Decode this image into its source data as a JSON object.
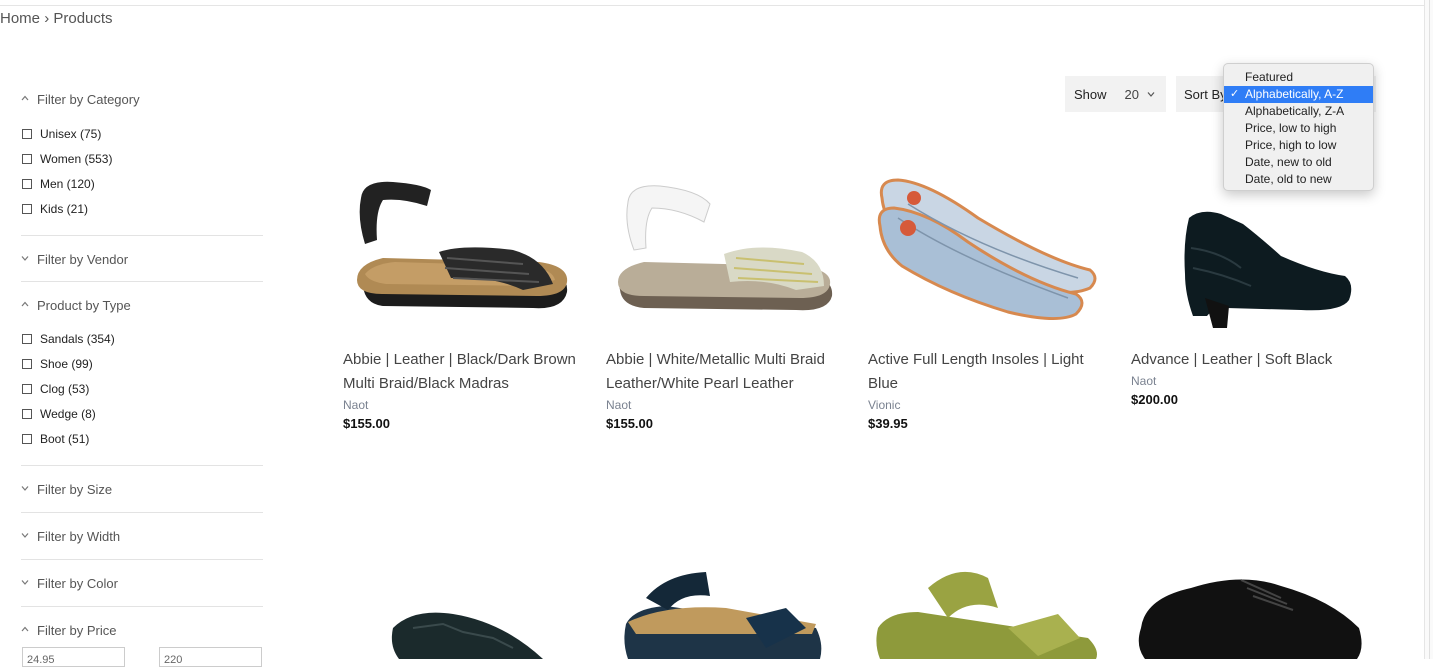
{
  "breadcrumb": {
    "home": "Home",
    "separator": "›",
    "current": "Products"
  },
  "filters": [
    {
      "title": "Filter by Category",
      "expanded": true,
      "options": [
        "Unisex (75)",
        "Women (553)",
        "Men (120)",
        "Kids (21)"
      ]
    },
    {
      "title": "Filter by Vendor",
      "expanded": false,
      "options": []
    },
    {
      "title": "Product by Type",
      "expanded": true,
      "options": [
        "Sandals (354)",
        "Shoe (99)",
        "Clog (53)",
        "Wedge (8)",
        "Boot (51)"
      ]
    },
    {
      "title": "Filter by Size",
      "expanded": false,
      "options": []
    },
    {
      "title": "Filter by Width",
      "expanded": false,
      "options": []
    },
    {
      "title": "Filter by Color",
      "expanded": false,
      "options": []
    },
    {
      "title": "Filter by Price",
      "expanded": true,
      "options": []
    }
  ],
  "price_inputs": {
    "min": "24.95",
    "max": "220"
  },
  "toolbar": {
    "show_label": "Show",
    "show_value": "20",
    "sort_label": "Sort By"
  },
  "sort_dropdown": {
    "selected": "Alphabetically, A-Z",
    "check": "✓",
    "options": [
      "Featured",
      "Alphabetically, A-Z",
      "Alphabetically, Z-A",
      "Price, low to high",
      "Price, high to low",
      "Date, new to old",
      "Date, old to new"
    ]
  },
  "products": [
    {
      "title": "Abbie | Leather | Black/Dark Brown Multi Braid/Black Madras",
      "vendor": "Naot",
      "price": "$155.00",
      "image": "sandal-black"
    },
    {
      "title": "Abbie | White/Metallic Multi Braid Leather/White Pearl Leather",
      "vendor": "Naot",
      "price": "$155.00",
      "image": "sandal-white"
    },
    {
      "title": "Active Full Length Insoles | Light Blue",
      "vendor": "Vionic",
      "price": "$39.95",
      "image": "insoles-blue"
    },
    {
      "title": "Advance | Leather | Soft Black",
      "vendor": "Naot",
      "price": "$200.00",
      "image": "bootie-black"
    }
  ],
  "colors": {
    "accent": "#2f7df6",
    "price": "#111111",
    "vendor": "#7a8290"
  }
}
